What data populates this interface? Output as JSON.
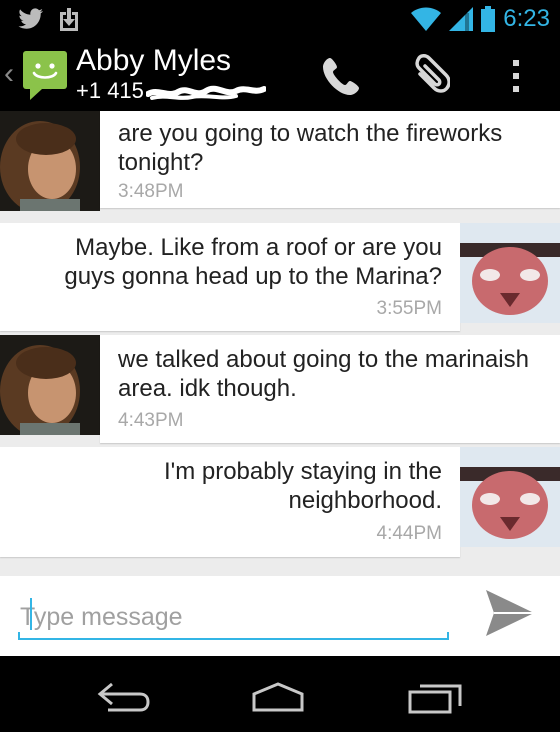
{
  "status_bar": {
    "time": "6:23"
  },
  "header": {
    "contact_name": "Abby Myles",
    "contact_number": "+1 415"
  },
  "compose": {
    "placeholder": "Type message"
  },
  "colors": {
    "accent": "#33b5e5",
    "app_green": "#8bc34a",
    "bubble": "#ffffff",
    "timestamp": "#a8a8a8"
  },
  "icons": [
    "twitter-icon",
    "download-icon",
    "wifi-icon",
    "signal-icon",
    "battery-icon",
    "messaging-app-icon",
    "phone-icon",
    "paperclip-icon",
    "overflow-menu-icon",
    "send-icon",
    "back-icon",
    "home-icon",
    "recents-icon"
  ],
  "messages": [
    {
      "direction": "incoming",
      "text": "are you going to watch the fireworks tonight?",
      "time": "3:48PM"
    },
    {
      "direction": "outgoing",
      "text": "Maybe. Like from a roof or are you guys gonna head up to the Marina?",
      "time": "3:55PM"
    },
    {
      "direction": "incoming",
      "text": "we talked about going to the marinaish area. idk though.",
      "time": "4:43PM"
    },
    {
      "direction": "outgoing",
      "text": "I'm probably staying in the neighborhood.",
      "time": "4:44PM"
    }
  ]
}
